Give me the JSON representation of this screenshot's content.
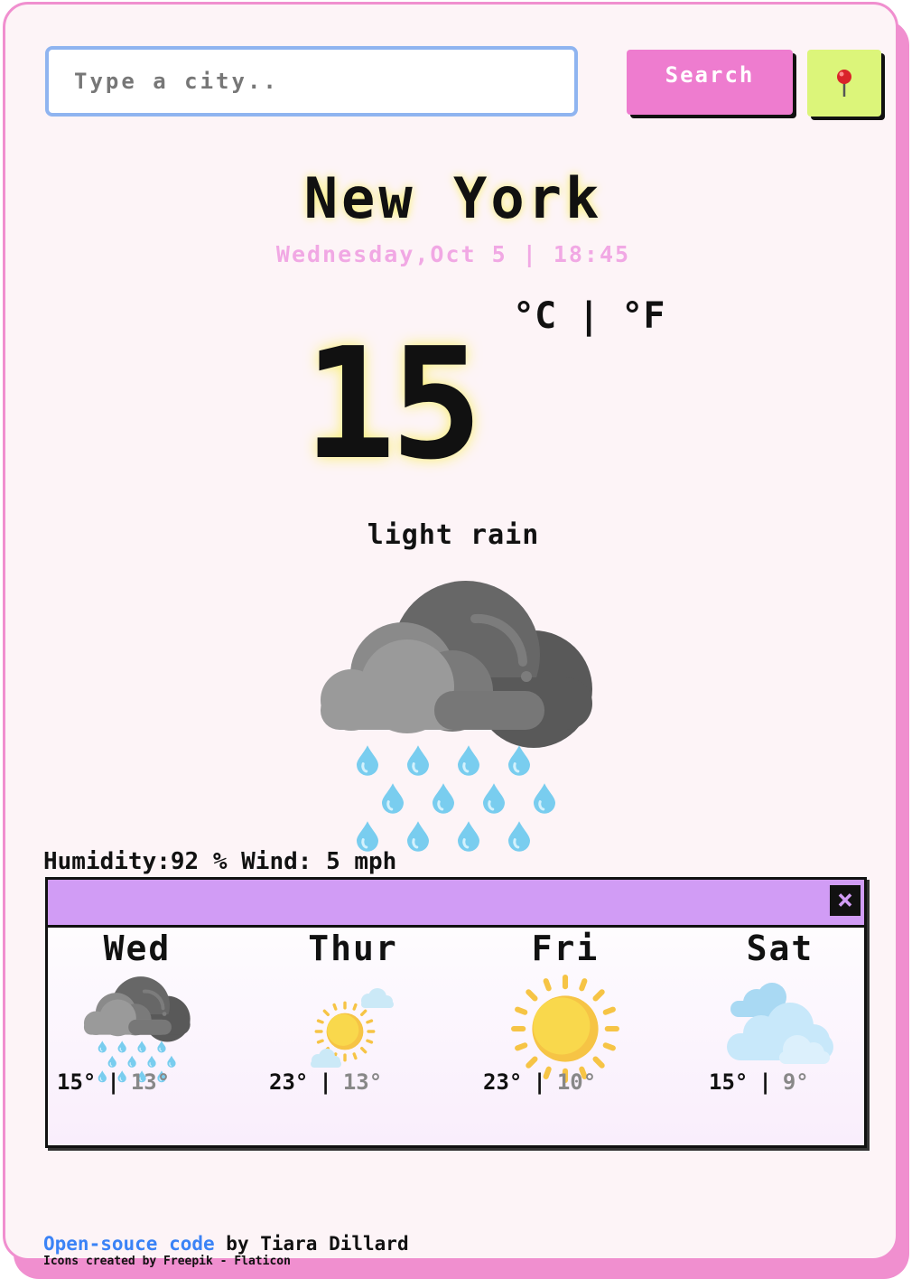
{
  "search": {
    "placeholder": "Type a city..",
    "button_label": "Search"
  },
  "location_button": {
    "icon": "map-pin-icon"
  },
  "weather": {
    "city": "New York",
    "date": "Wednesday,Oct 5 | 18:45",
    "units": {
      "celsius": "°C",
      "separator": "|",
      "fahrenheit": "°F"
    },
    "temperature": "15",
    "description": "light rain",
    "icon": "rain-cloud-icon",
    "stats": "Humidity:92 % Wind: 5 mph"
  },
  "forecast": {
    "close_label": "×",
    "days": [
      {
        "day": "Wed",
        "high": "15°",
        "sep": "|",
        "low": "13°",
        "icon": "rain-cloud-icon"
      },
      {
        "day": "Thur",
        "high": "23°",
        "sep": "|",
        "low": "13°",
        "icon": "sun-cloud-icon"
      },
      {
        "day": "Fri",
        "high": "23°",
        "sep": "|",
        "low": "10°",
        "icon": "sun-icon"
      },
      {
        "day": "Sat",
        "high": "15°",
        "sep": "|",
        "low": "9°",
        "icon": "clouds-icon"
      }
    ]
  },
  "footer": {
    "link_text": "Open-souce code",
    "credit_text": " by Tiara Dillard",
    "icons_credit": "Icons created by Freepik - Flaticon"
  },
  "colors": {
    "card_border": "#f08fcf",
    "search_button": "#ee7ccf",
    "location_button": "#dcf57a",
    "forecast_header": "#d19cf5",
    "date_text": "#f1a8e4",
    "link": "#3b83f6"
  }
}
